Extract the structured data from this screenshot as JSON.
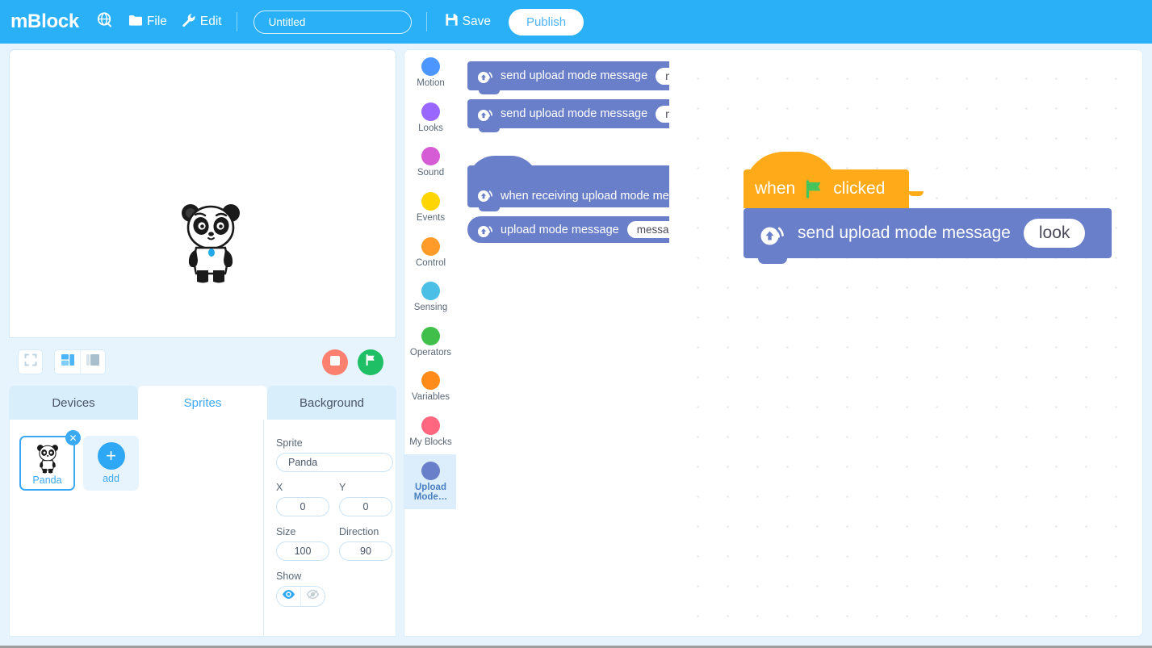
{
  "topbar": {
    "brand": "mBlock",
    "globe_icon": "globe-icon",
    "file_icon": "folder-icon",
    "file_label": "File",
    "edit_icon": "wrench-icon",
    "edit_label": "Edit",
    "project_title_value": "Untitled",
    "project_title_placeholder": "Untitled",
    "save_icon": "floppy-disk-icon",
    "save_label": "Save",
    "publish_label": "Publish",
    "bg_color": "#29b0f7",
    "publish_text_color": "#4fb3f8"
  },
  "stage": {
    "sprite_on_stage": "Panda"
  },
  "stage_controls": {
    "fullscreen_icon": "fullscreen-icon",
    "layout_small_icon": "layout-small-stage-icon",
    "layout_large_icon": "layout-large-stage-icon",
    "stop_icon": "stop-icon",
    "stop_color": "#fb8070",
    "flag_icon": "green-flag-icon",
    "flag_color": "#1fbf65"
  },
  "tabs": [
    {
      "label": "Devices",
      "active": false
    },
    {
      "label": "Sprites",
      "active": true
    },
    {
      "label": "Background",
      "active": false
    }
  ],
  "sprite_panel": {
    "sprite_card": {
      "name": "Panda",
      "close_icon": "close-icon",
      "selected": true
    },
    "add_card": {
      "label": "add",
      "plus_icon": "plus-icon"
    },
    "properties": {
      "sprite_label": "Sprite",
      "sprite_value": "Panda",
      "x_label": "X",
      "x_value": "0",
      "y_label": "Y",
      "y_value": "0",
      "size_label": "Size",
      "size_value": "100",
      "direction_label": "Direction",
      "direction_value": "90",
      "show_label": "Show",
      "show_icon": "eye-open-icon",
      "hide_icon": "eye-closed-icon",
      "show_selected": true
    }
  },
  "categories": [
    {
      "label": "Motion",
      "color": "#4c97ff",
      "selected": false
    },
    {
      "label": "Looks",
      "color": "#9966ff",
      "selected": false
    },
    {
      "label": "Sound",
      "color": "#d65cd6",
      "selected": false
    },
    {
      "label": "Events",
      "color": "#ffd500",
      "selected": false
    },
    {
      "label": "Control",
      "color": "#ff9b28",
      "selected": false
    },
    {
      "label": "Sensing",
      "color": "#4cbfe6",
      "selected": false
    },
    {
      "label": "Operators",
      "color": "#40bf4a",
      "selected": false
    },
    {
      "label": "Variables",
      "color": "#ff8c1a",
      "selected": false
    },
    {
      "label": "My Blocks",
      "color": "#ff6680",
      "selected": false
    },
    {
      "label": "Upload Mode…",
      "color": "#6a7fc9",
      "selected": true
    }
  ],
  "palette": {
    "blocks": [
      {
        "kind": "stack",
        "icon": "upload-signal-icon",
        "text": "send upload mode message",
        "input_value": "message"
      },
      {
        "kind": "stack",
        "icon": "upload-signal-icon",
        "text": "send upload mode message",
        "input_value": "message"
      },
      {
        "kind": "hat",
        "icon": "upload-signal-icon",
        "text": "when receiving upload mode message",
        "input_value": ""
      },
      {
        "kind": "reporter",
        "icon": "upload-signal-icon",
        "text": "upload mode message",
        "input_value": "message"
      }
    ],
    "block_color": "#6a7fc9"
  },
  "canvas": {
    "script": {
      "hat": {
        "word_before": "when",
        "flag_icon": "green-flag-icon",
        "word_after": "clicked",
        "color": "#ffab19"
      },
      "command": {
        "icon": "upload-signal-icon",
        "text": "send upload mode message",
        "input_value": "look",
        "color": "#6a7fc9"
      }
    }
  }
}
